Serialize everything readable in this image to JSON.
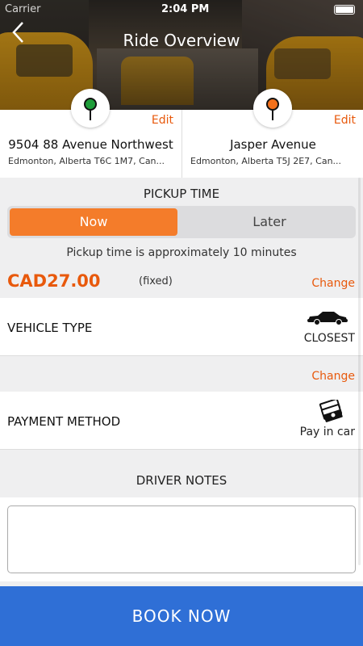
{
  "statusbar": {
    "carrier": "Carrier",
    "time": "2:04 PM"
  },
  "header": {
    "title": "Ride Overview"
  },
  "pickup": {
    "street": "9504 88 Avenue Northwest",
    "city": "Edmonton, Alberta T6C 1M7, Can...",
    "edit_label": "Edit",
    "pin_color": "#1f9d3a"
  },
  "dropoff": {
    "street": "Jasper Avenue",
    "city": "Edmonton, Alberta T5J 2E7, Can...",
    "edit_label": "Edit",
    "pin_color": "#f2711c"
  },
  "pickup_time": {
    "title": "PICKUP TIME",
    "options": [
      "Now",
      "Later"
    ],
    "selected": "Now",
    "note": "Pickup time is approximately 10 minutes"
  },
  "fare": {
    "price": "CAD27.00",
    "type": "(fixed)",
    "change_label": "Change"
  },
  "vehicle": {
    "label": "VEHICLE TYPE",
    "value": "CLOSEST",
    "icon": "car-icon"
  },
  "payment": {
    "change_label": "Change",
    "label": "PAYMENT METHOD",
    "value": "Pay in car",
    "icon": "cash-icon"
  },
  "notes": {
    "title": "DRIVER NOTES",
    "value": ""
  },
  "book_button": {
    "label": "BOOK NOW"
  },
  "colors": {
    "accent": "#f47c2a",
    "link": "#e8590c",
    "primary": "#2f6fd6"
  }
}
